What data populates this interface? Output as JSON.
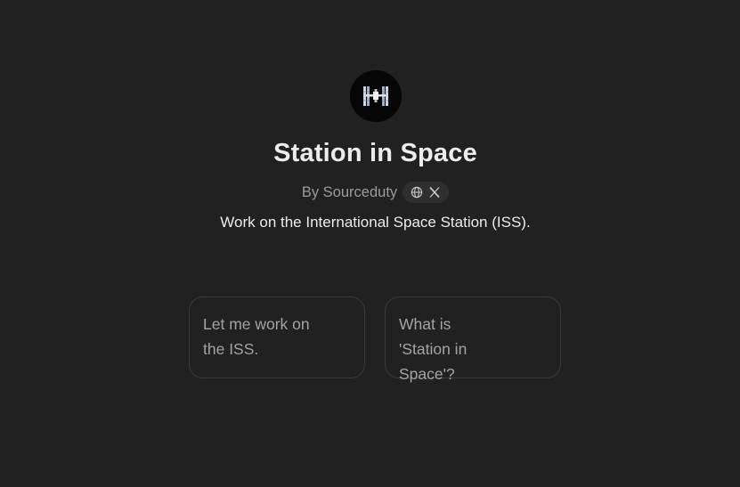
{
  "gpt": {
    "name": "Station in Space",
    "byline": "By Sourceduty",
    "description": "Work on the International Space Station (ISS).",
    "avatar_icon": "space-station-icon",
    "social_icons": [
      "globe-icon",
      "x-logo-icon"
    ]
  },
  "starters": [
    {
      "text": "Let me work on the ISS."
    },
    {
      "text": "What is 'Station in Space'?"
    }
  ],
  "colors": {
    "background": "#212121",
    "text": "#ececec",
    "muted": "#9b9b9b",
    "card_border": "#3a3a3a"
  }
}
